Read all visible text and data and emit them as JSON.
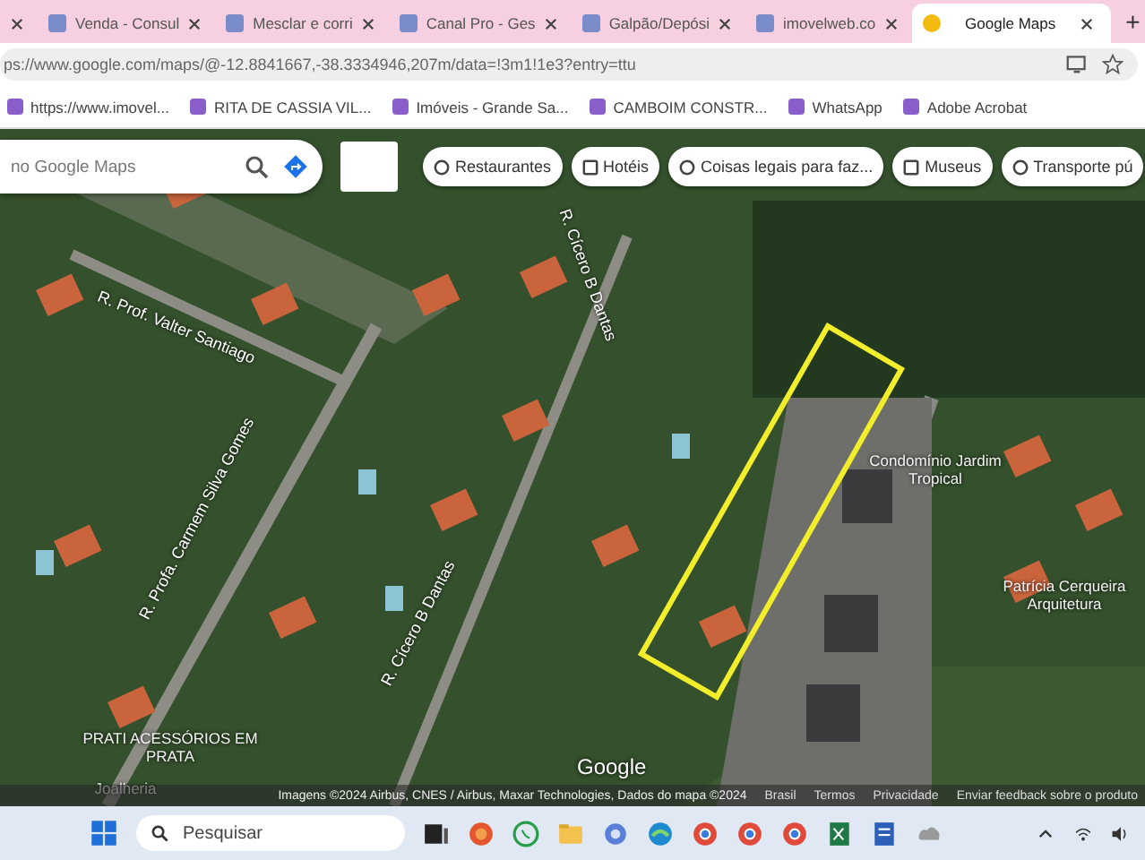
{
  "tabs": [
    {
      "selected": false
    },
    {
      "label": "Venda - Consul",
      "selected": false
    },
    {
      "label": "Mesclar e corri",
      "selected": false
    },
    {
      "label": "Canal Pro - Ges",
      "selected": false
    },
    {
      "label": "Galpão/Depósi",
      "selected": false
    },
    {
      "label": "imovelweb.co",
      "selected": false
    },
    {
      "label": "Google Maps",
      "selected": true
    }
  ],
  "new_tab": "+",
  "address_bar": {
    "url": "ps://www.google.com/maps/@-12.8841667,-38.3334946,207m/data=!3m1!1e3?entry=ttu"
  },
  "bookmarks": [
    "https://www.imovel...",
    "RITA DE CASSIA VIL...",
    "Imóveis - Grande Sa...",
    "CAMBOIM CONSTR...",
    "WhatsApp",
    "Adobe Acrobat"
  ],
  "map": {
    "search": {
      "placeholder": "no Google Maps"
    },
    "chips": [
      "Restaurantes",
      "Hotéis",
      "Coisas legais para faz...",
      "Museus",
      "Transporte pú"
    ],
    "street_labels": [
      "R. Prof. Valter Santiago",
      "R. Profa. Carmem Silva Gomes",
      "R. Cícero B Dantas",
      "R. Cícero B Dantas"
    ],
    "places": [
      "Condomínio Jardim Tropical",
      "Patrícia Cerqueira Arquitetura",
      "PRATI ACESSÓRIOS EM PRATA",
      "Joalheria"
    ],
    "logo": "Google",
    "attribution": "Imagens ©2024 Airbus, CNES / Airbus, Maxar Technologies, Dados do mapa ©2024",
    "footer_links": [
      "Brasil",
      "Termos",
      "Privacidade",
      "Enviar feedback sobre o produto"
    ]
  },
  "taskbar": {
    "search": {
      "placeholder": "Pesquisar"
    }
  }
}
